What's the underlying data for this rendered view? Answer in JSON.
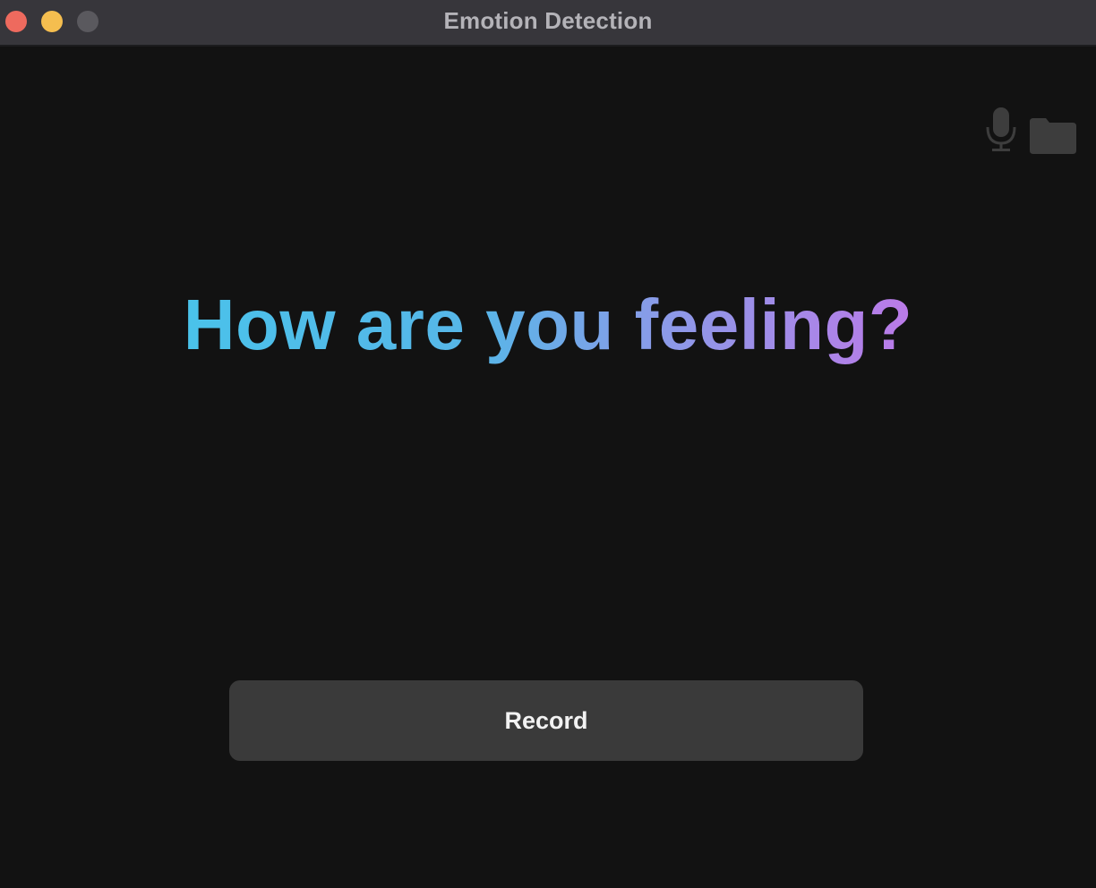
{
  "window": {
    "title": "Emotion Detection",
    "controls": {
      "close_color": "#ee6a5e",
      "minimize_color": "#f5be4f",
      "zoom_color": "#5a595e"
    }
  },
  "toolbar": {
    "icons": [
      "microphone-icon",
      "folder-icon"
    ],
    "icon_color": "#3d3d3d"
  },
  "main": {
    "prompt": "How are you feeling?",
    "prompt_gradient": [
      "#4ac2ea",
      "#bb7ae8"
    ],
    "record_label": "Record"
  },
  "colors": {
    "background": "#121212",
    "titlebar": "#37363b",
    "button": "#3a3a3a"
  }
}
